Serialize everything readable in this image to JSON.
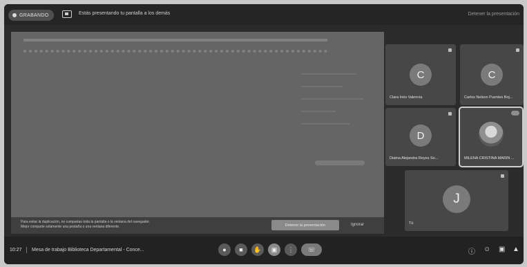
{
  "topbar": {
    "recording_label": "GRABANDO",
    "presenting_text": "Estás presentando tu pantalla a los demás",
    "stop_label": "Detener la presentación"
  },
  "document": {
    "paragraphs": [
      "",
      "",
      "",
      "",
      ""
    ]
  },
  "warning": {
    "line1": "Para evitar la duplicación, no compartas toda la pantalla o la ventana del navegador.",
    "line2": "Mejor comparte solamente una pestaña o una ventana diferente.",
    "stop_button": "Detener la presentación",
    "ignore_button": "Ignorar"
  },
  "participants": [
    {
      "initial": "C",
      "name": "Clara Inés Valencia"
    },
    {
      "initial": "C",
      "name": "Carlos Nelson Puentes Boj..."
    },
    {
      "initial": "D",
      "name": "Diatna Alejandra Reyes So..."
    },
    {
      "initial": "",
      "name": "MILENA CRISTINA MARIN ..."
    },
    {
      "initial": "J",
      "name": "Tú"
    }
  ],
  "bottombar": {
    "time": "10:27",
    "meeting_title": "Mesa de trabajo Biblioteca Departamental - Conce..."
  },
  "icons": {
    "record": "record-dot-icon",
    "present": "present-screen-icon",
    "mic": "mic-icon",
    "camera": "camera-icon",
    "hand": "raise-hand-icon",
    "present_now": "present-now-icon",
    "more": "more-options-icon",
    "end_call": "end-call-icon",
    "info": "info-icon",
    "people": "people-icon",
    "chat": "chat-icon",
    "activities": "activities-icon"
  },
  "colors": {
    "background": "#2b2b2b",
    "tile": "#474747",
    "shared": "#656565"
  }
}
